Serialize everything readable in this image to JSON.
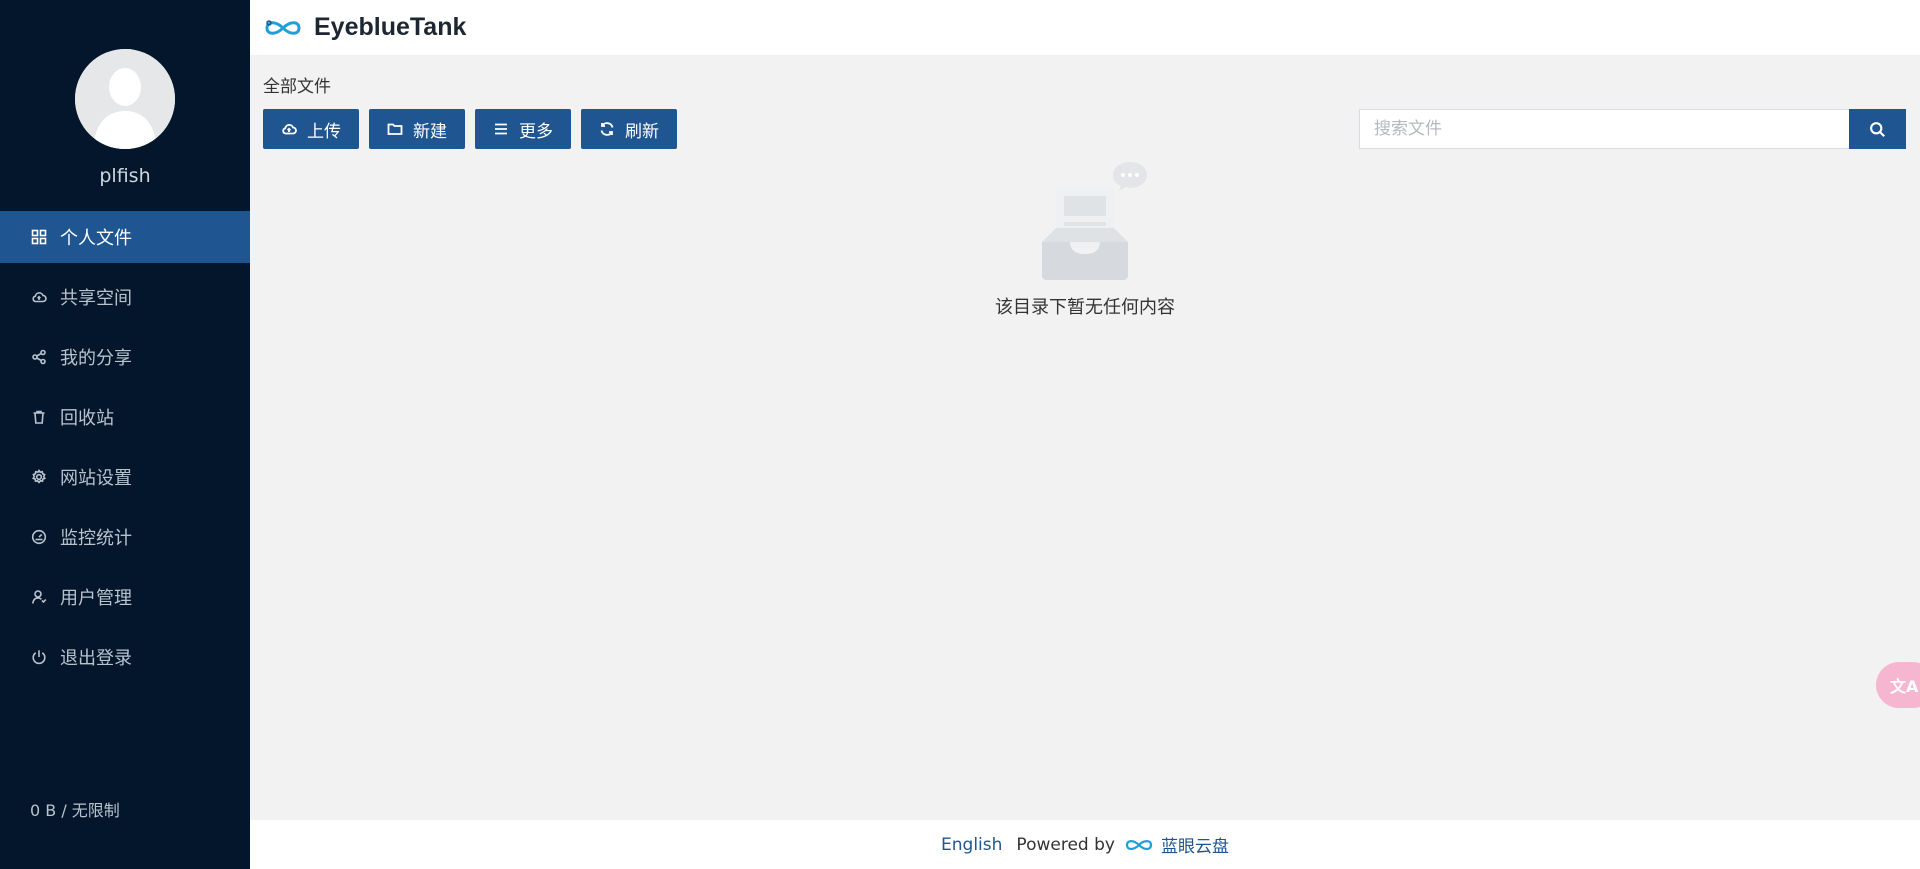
{
  "app": {
    "title": "EyeblueTank"
  },
  "user": {
    "name": "plfish",
    "storage": "0 B / 无限制"
  },
  "sidebar": {
    "items": [
      {
        "label": "个人文件",
        "icon": "grid-icon",
        "active": true
      },
      {
        "label": "共享空间",
        "icon": "cloud-icon",
        "active": false
      },
      {
        "label": "我的分享",
        "icon": "share-icon",
        "active": false
      },
      {
        "label": "回收站",
        "icon": "trash-icon",
        "active": false
      },
      {
        "label": "网站设置",
        "icon": "gear-icon",
        "active": false
      },
      {
        "label": "监控统计",
        "icon": "dashboard-icon",
        "active": false
      },
      {
        "label": "用户管理",
        "icon": "user-icon",
        "active": false
      },
      {
        "label": "退出登录",
        "icon": "power-icon",
        "active": false
      }
    ]
  },
  "main": {
    "breadcrumb": "全部文件",
    "toolbar": {
      "upload": "上传",
      "new": "新建",
      "more": "更多",
      "refresh": "刷新"
    },
    "search": {
      "placeholder": "搜索文件",
      "value": ""
    },
    "empty_text": "该目录下暂无任何内容"
  },
  "footer": {
    "language": "English",
    "powered_by": "Powered by",
    "brand": "蓝眼云盘"
  },
  "colors": {
    "sidebar_bg": "#04162b",
    "accent": "#1f5590",
    "page_bg": "#f2f2f2"
  }
}
